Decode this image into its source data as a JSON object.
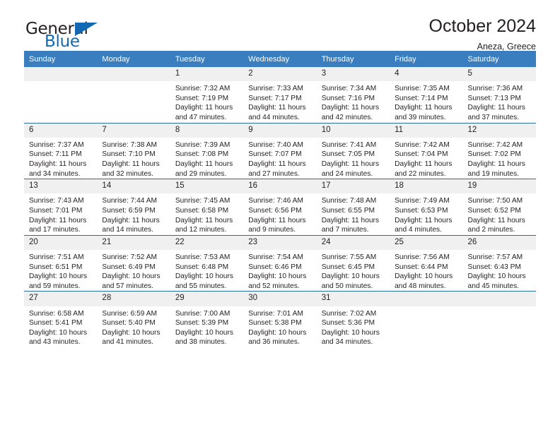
{
  "brand": {
    "name_part1": "General",
    "name_part2": "Blue",
    "triangle_icon": "triangle-icon",
    "accent_color": "#1268b3"
  },
  "header": {
    "title": "October 2024",
    "location": "Aneza, Greece"
  },
  "calendar": {
    "header_bg": "#3a7ebf",
    "row_divider": "#2b6ca3",
    "daynum_bg": "#f0f0f0",
    "weekday_headers": [
      "Sunday",
      "Monday",
      "Tuesday",
      "Wednesday",
      "Thursday",
      "Friday",
      "Saturday"
    ],
    "labels": {
      "sunrise": "Sunrise:",
      "sunset": "Sunset:",
      "daylight": "Daylight:"
    },
    "weeks": [
      [
        {
          "day": "",
          "sunrise": "",
          "sunset": "",
          "daylight_line1": "",
          "daylight_line2": ""
        },
        {
          "day": "",
          "sunrise": "",
          "sunset": "",
          "daylight_line1": "",
          "daylight_line2": ""
        },
        {
          "day": "1",
          "sunrise": "Sunrise: 7:32 AM",
          "sunset": "Sunset: 7:19 PM",
          "daylight_line1": "Daylight: 11 hours",
          "daylight_line2": "and 47 minutes."
        },
        {
          "day": "2",
          "sunrise": "Sunrise: 7:33 AM",
          "sunset": "Sunset: 7:17 PM",
          "daylight_line1": "Daylight: 11 hours",
          "daylight_line2": "and 44 minutes."
        },
        {
          "day": "3",
          "sunrise": "Sunrise: 7:34 AM",
          "sunset": "Sunset: 7:16 PM",
          "daylight_line1": "Daylight: 11 hours",
          "daylight_line2": "and 42 minutes."
        },
        {
          "day": "4",
          "sunrise": "Sunrise: 7:35 AM",
          "sunset": "Sunset: 7:14 PM",
          "daylight_line1": "Daylight: 11 hours",
          "daylight_line2": "and 39 minutes."
        },
        {
          "day": "5",
          "sunrise": "Sunrise: 7:36 AM",
          "sunset": "Sunset: 7:13 PM",
          "daylight_line1": "Daylight: 11 hours",
          "daylight_line2": "and 37 minutes."
        }
      ],
      [
        {
          "day": "6",
          "sunrise": "Sunrise: 7:37 AM",
          "sunset": "Sunset: 7:11 PM",
          "daylight_line1": "Daylight: 11 hours",
          "daylight_line2": "and 34 minutes."
        },
        {
          "day": "7",
          "sunrise": "Sunrise: 7:38 AM",
          "sunset": "Sunset: 7:10 PM",
          "daylight_line1": "Daylight: 11 hours",
          "daylight_line2": "and 32 minutes."
        },
        {
          "day": "8",
          "sunrise": "Sunrise: 7:39 AM",
          "sunset": "Sunset: 7:08 PM",
          "daylight_line1": "Daylight: 11 hours",
          "daylight_line2": "and 29 minutes."
        },
        {
          "day": "9",
          "sunrise": "Sunrise: 7:40 AM",
          "sunset": "Sunset: 7:07 PM",
          "daylight_line1": "Daylight: 11 hours",
          "daylight_line2": "and 27 minutes."
        },
        {
          "day": "10",
          "sunrise": "Sunrise: 7:41 AM",
          "sunset": "Sunset: 7:05 PM",
          "daylight_line1": "Daylight: 11 hours",
          "daylight_line2": "and 24 minutes."
        },
        {
          "day": "11",
          "sunrise": "Sunrise: 7:42 AM",
          "sunset": "Sunset: 7:04 PM",
          "daylight_line1": "Daylight: 11 hours",
          "daylight_line2": "and 22 minutes."
        },
        {
          "day": "12",
          "sunrise": "Sunrise: 7:42 AM",
          "sunset": "Sunset: 7:02 PM",
          "daylight_line1": "Daylight: 11 hours",
          "daylight_line2": "and 19 minutes."
        }
      ],
      [
        {
          "day": "13",
          "sunrise": "Sunrise: 7:43 AM",
          "sunset": "Sunset: 7:01 PM",
          "daylight_line1": "Daylight: 11 hours",
          "daylight_line2": "and 17 minutes."
        },
        {
          "day": "14",
          "sunrise": "Sunrise: 7:44 AM",
          "sunset": "Sunset: 6:59 PM",
          "daylight_line1": "Daylight: 11 hours",
          "daylight_line2": "and 14 minutes."
        },
        {
          "day": "15",
          "sunrise": "Sunrise: 7:45 AM",
          "sunset": "Sunset: 6:58 PM",
          "daylight_line1": "Daylight: 11 hours",
          "daylight_line2": "and 12 minutes."
        },
        {
          "day": "16",
          "sunrise": "Sunrise: 7:46 AM",
          "sunset": "Sunset: 6:56 PM",
          "daylight_line1": "Daylight: 11 hours",
          "daylight_line2": "and 9 minutes."
        },
        {
          "day": "17",
          "sunrise": "Sunrise: 7:48 AM",
          "sunset": "Sunset: 6:55 PM",
          "daylight_line1": "Daylight: 11 hours",
          "daylight_line2": "and 7 minutes."
        },
        {
          "day": "18",
          "sunrise": "Sunrise: 7:49 AM",
          "sunset": "Sunset: 6:53 PM",
          "daylight_line1": "Daylight: 11 hours",
          "daylight_line2": "and 4 minutes."
        },
        {
          "day": "19",
          "sunrise": "Sunrise: 7:50 AM",
          "sunset": "Sunset: 6:52 PM",
          "daylight_line1": "Daylight: 11 hours",
          "daylight_line2": "and 2 minutes."
        }
      ],
      [
        {
          "day": "20",
          "sunrise": "Sunrise: 7:51 AM",
          "sunset": "Sunset: 6:51 PM",
          "daylight_line1": "Daylight: 10 hours",
          "daylight_line2": "and 59 minutes."
        },
        {
          "day": "21",
          "sunrise": "Sunrise: 7:52 AM",
          "sunset": "Sunset: 6:49 PM",
          "daylight_line1": "Daylight: 10 hours",
          "daylight_line2": "and 57 minutes."
        },
        {
          "day": "22",
          "sunrise": "Sunrise: 7:53 AM",
          "sunset": "Sunset: 6:48 PM",
          "daylight_line1": "Daylight: 10 hours",
          "daylight_line2": "and 55 minutes."
        },
        {
          "day": "23",
          "sunrise": "Sunrise: 7:54 AM",
          "sunset": "Sunset: 6:46 PM",
          "daylight_line1": "Daylight: 10 hours",
          "daylight_line2": "and 52 minutes."
        },
        {
          "day": "24",
          "sunrise": "Sunrise: 7:55 AM",
          "sunset": "Sunset: 6:45 PM",
          "daylight_line1": "Daylight: 10 hours",
          "daylight_line2": "and 50 minutes."
        },
        {
          "day": "25",
          "sunrise": "Sunrise: 7:56 AM",
          "sunset": "Sunset: 6:44 PM",
          "daylight_line1": "Daylight: 10 hours",
          "daylight_line2": "and 48 minutes."
        },
        {
          "day": "26",
          "sunrise": "Sunrise: 7:57 AM",
          "sunset": "Sunset: 6:43 PM",
          "daylight_line1": "Daylight: 10 hours",
          "daylight_line2": "and 45 minutes."
        }
      ],
      [
        {
          "day": "27",
          "sunrise": "Sunrise: 6:58 AM",
          "sunset": "Sunset: 5:41 PM",
          "daylight_line1": "Daylight: 10 hours",
          "daylight_line2": "and 43 minutes."
        },
        {
          "day": "28",
          "sunrise": "Sunrise: 6:59 AM",
          "sunset": "Sunset: 5:40 PM",
          "daylight_line1": "Daylight: 10 hours",
          "daylight_line2": "and 41 minutes."
        },
        {
          "day": "29",
          "sunrise": "Sunrise: 7:00 AM",
          "sunset": "Sunset: 5:39 PM",
          "daylight_line1": "Daylight: 10 hours",
          "daylight_line2": "and 38 minutes."
        },
        {
          "day": "30",
          "sunrise": "Sunrise: 7:01 AM",
          "sunset": "Sunset: 5:38 PM",
          "daylight_line1": "Daylight: 10 hours",
          "daylight_line2": "and 36 minutes."
        },
        {
          "day": "31",
          "sunrise": "Sunrise: 7:02 AM",
          "sunset": "Sunset: 5:36 PM",
          "daylight_line1": "Daylight: 10 hours",
          "daylight_line2": "and 34 minutes."
        },
        {
          "day": "",
          "sunrise": "",
          "sunset": "",
          "daylight_line1": "",
          "daylight_line2": ""
        },
        {
          "day": "",
          "sunrise": "",
          "sunset": "",
          "daylight_line1": "",
          "daylight_line2": ""
        }
      ]
    ]
  }
}
